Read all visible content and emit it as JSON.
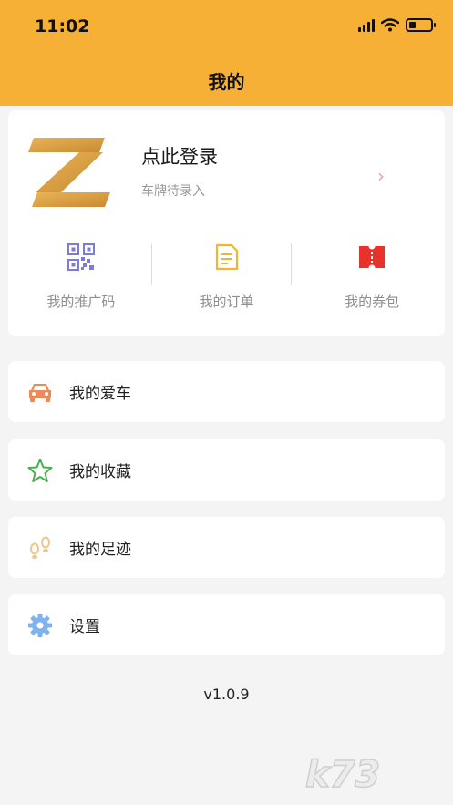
{
  "status": {
    "time": "11:02"
  },
  "header": {
    "title": "我的"
  },
  "profile": {
    "login_label": "点此登录",
    "plate_hint": "车牌待录入",
    "quick": [
      {
        "label": "我的推广码",
        "icon": "qr-code-icon",
        "color": "#7c7cd6"
      },
      {
        "label": "我的订单",
        "icon": "order-icon",
        "color": "#f4b333"
      },
      {
        "label": "我的券包",
        "icon": "coupon-icon",
        "color": "#e8322c"
      }
    ]
  },
  "menu": [
    {
      "label": "我的爱车",
      "icon": "car-icon",
      "color": "#ee8a5a"
    },
    {
      "label": "我的收藏",
      "icon": "star-icon",
      "color": "#4caf50"
    },
    {
      "label": "我的足迹",
      "icon": "footprint-icon",
      "color": "#f0c48e"
    },
    {
      "label": "设置",
      "icon": "gear-icon",
      "color": "#7fb3ee"
    }
  ],
  "version": "v1.0.9",
  "watermark": "k73",
  "colors": {
    "header": "#f7b036",
    "background": "#f4f4f4"
  }
}
